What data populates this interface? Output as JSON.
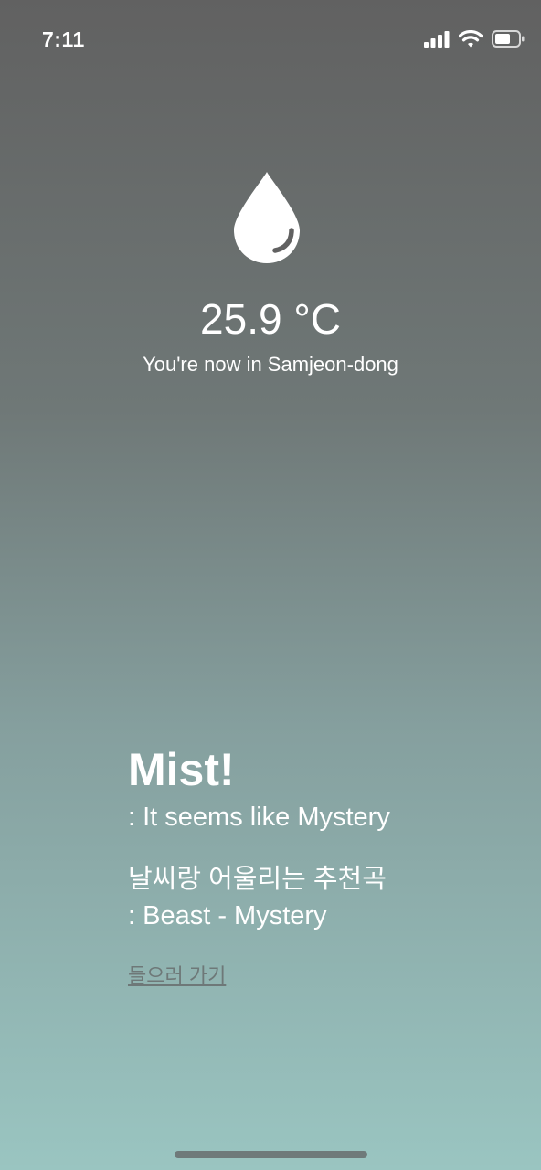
{
  "status_bar": {
    "time": "7:11",
    "signal_icon": "cellular-signal-icon",
    "wifi_icon": "wifi-icon",
    "battery_icon": "battery-icon"
  },
  "weather": {
    "icon": "water-drop-icon",
    "temperature": "25.9 °C",
    "location_text": "You're now in Samjeon-dong",
    "condition_title": "Mist!",
    "condition_desc": " : It seems like Mystery"
  },
  "recommendation": {
    "heading": "날씨랑 어울리는 추천곡",
    "song": " : Beast - Mystery",
    "link_label": "들으러 가기"
  },
  "colors": {
    "gradient_top": "#616161",
    "gradient_bottom": "#9ac5c1",
    "link": "#6e7878"
  }
}
